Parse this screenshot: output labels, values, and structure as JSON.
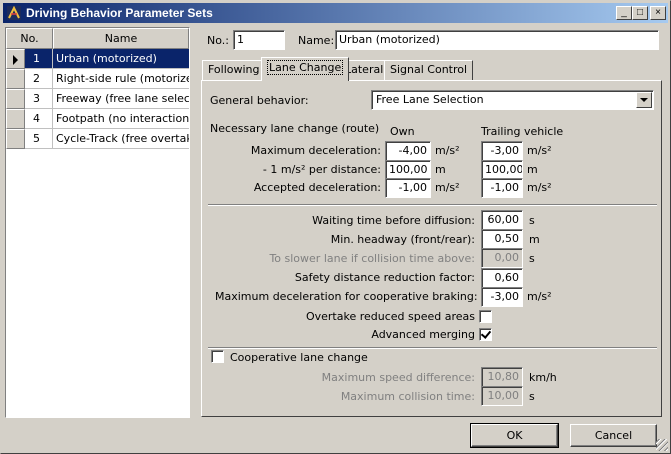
{
  "window": {
    "title": "Driving Behavior Parameter Sets",
    "min_glyph": "_",
    "max_glyph": "□",
    "close_glyph": "×"
  },
  "list": {
    "col_no": "No.",
    "col_name": "Name",
    "rows": [
      {
        "no": "1",
        "name": "Urban (motorized)"
      },
      {
        "no": "2",
        "name": "Right-side rule (motorize"
      },
      {
        "no": "3",
        "name": "Freeway (free lane selecti"
      },
      {
        "no": "4",
        "name": "Footpath (no interaction)"
      },
      {
        "no": "5",
        "name": "Cycle-Track (free overtaki"
      }
    ]
  },
  "header": {
    "no_label": "No.:",
    "no_value": "1",
    "name_label": "Name:",
    "name_value": "Urban (motorized)"
  },
  "tabs": [
    "Following",
    "Lane Change",
    "Lateral",
    "Signal Control"
  ],
  "lane_change": {
    "general_label": "General behavior:",
    "general_value": "Free Lane Selection",
    "necessary_title": "Necessary lane change (route)",
    "col_own": "Own",
    "col_trailing": "Trailing vehicle",
    "max_decel_label": "Maximum deceleration:",
    "max_decel_own": "-4,00",
    "max_decel_trail": "-3,00",
    "max_decel_unit": "m/s²",
    "per_dist_label": "- 1 m/s² per distance:",
    "per_dist_own": "100,00",
    "per_dist_trail": "100,00",
    "per_dist_unit": "m",
    "acc_decel_label": "Accepted deceleration:",
    "acc_decel_own": "-1,00",
    "acc_decel_trail": "-1,00",
    "acc_decel_unit": "m/s²",
    "waiting_label": "Waiting time before diffusion:",
    "waiting_value": "60,00",
    "waiting_unit": "s",
    "headway_label": "Min. headway (front/rear):",
    "headway_value": "0,50",
    "headway_unit": "m",
    "slower_label": "To slower lane if collision time above:",
    "slower_value": "0,00",
    "slower_unit": "s",
    "safety_label": "Safety distance reduction factor:",
    "safety_value": "0,60",
    "coop_brake_label": "Maximum deceleration for cooperative braking:",
    "coop_brake_value": "-3,00",
    "coop_brake_unit": "m/s²",
    "overtake_label": "Overtake reduced speed areas",
    "overtake_checked": false,
    "merging_label": "Advanced merging",
    "merging_checked": true,
    "coop_label": "Cooperative lane change",
    "coop_checked": false,
    "max_speed_label": "Maximum speed difference:",
    "max_speed_value": "10,80",
    "max_speed_unit": "km/h",
    "max_coll_label": "Maximum collision time:",
    "max_coll_value": "10,00",
    "max_coll_unit": "s"
  },
  "buttons": {
    "ok": "OK",
    "cancel": "Cancel"
  }
}
